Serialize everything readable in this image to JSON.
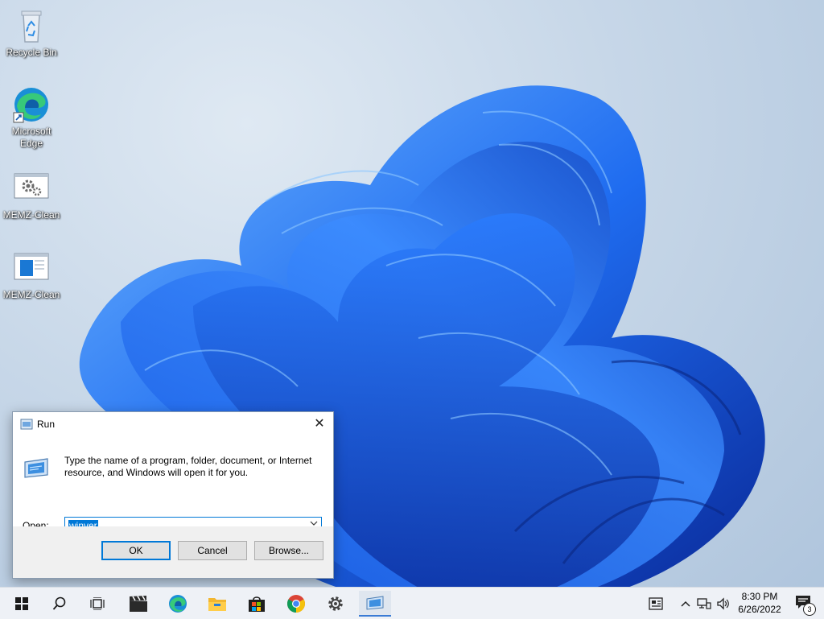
{
  "desktop": {
    "icons": [
      {
        "label": "Recycle Bin",
        "icon": "recycle-bin-icon"
      },
      {
        "label": "Microsoft Edge",
        "icon": "edge-icon"
      },
      {
        "label": "MEMZ-Clean",
        "icon": "gear-app-icon"
      },
      {
        "label": "MEMZ-Clean",
        "icon": "window-app-icon"
      }
    ]
  },
  "run_dialog": {
    "title": "Run",
    "description": "Type the name of a program, folder, document, or Internet resource, and Windows will open it for you.",
    "open_label": "Open:",
    "open_value": "winver",
    "ok_label": "OK",
    "cancel_label": "Cancel",
    "browse_label": "Browse..."
  },
  "taskbar": {
    "apps": [
      "start-icon",
      "search-icon",
      "task-view-icon",
      "video-editor-icon",
      "edge-icon",
      "file-explorer-icon",
      "store-icon",
      "chrome-icon",
      "settings-icon",
      "run-icon"
    ],
    "time": "8:30 PM",
    "date": "6/26/2022",
    "notification_count": "3"
  },
  "colors": {
    "accent": "#0078d7",
    "bloom_blue": "#1f6cf0"
  }
}
